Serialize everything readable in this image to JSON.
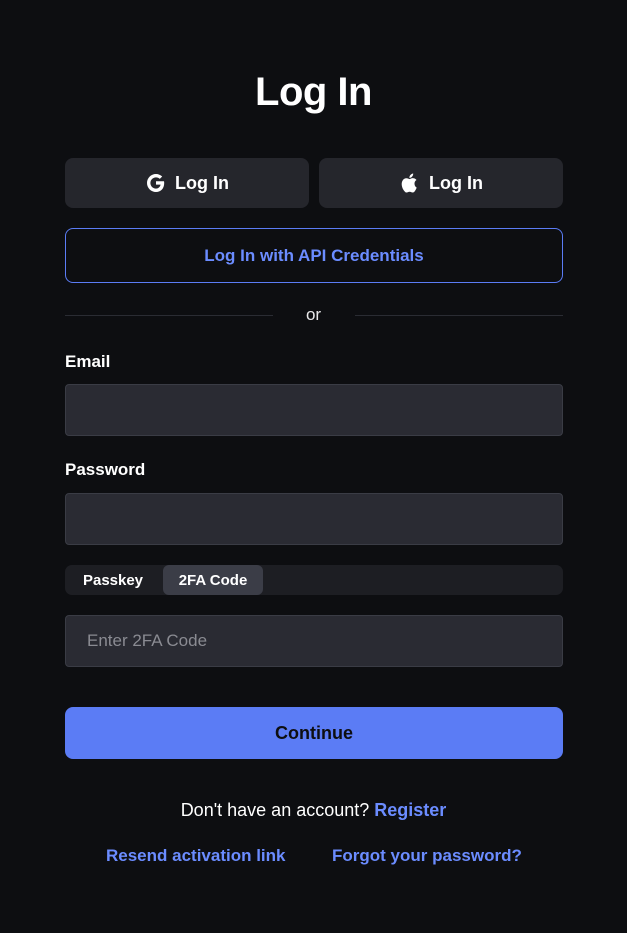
{
  "page": {
    "title": "Log In"
  },
  "social": {
    "google_label": "Log In",
    "apple_label": "Log In",
    "google_icon": "google-icon",
    "apple_icon": "apple-icon"
  },
  "api_button": {
    "label": "Log In with API Credentials"
  },
  "divider": {
    "text": "or"
  },
  "form": {
    "email_label": "Email",
    "email_value": "",
    "password_label": "Password",
    "password_value": "",
    "tabs": [
      {
        "label": "Passkey",
        "selected": false
      },
      {
        "label": "2FA Code",
        "selected": true
      }
    ],
    "twofa_placeholder": "Enter 2FA Code",
    "twofa_value": "",
    "continue_label": "Continue"
  },
  "footer": {
    "register_prompt": "Don't have an account?",
    "register_link": "Register",
    "resend_link": "Resend activation link",
    "forgot_link": "Forgot your password?"
  },
  "colors": {
    "background": "#0d0e11",
    "accent": "#5b7cf5",
    "link": "#6b8cff",
    "surface": "#25262c",
    "input_bg": "#2a2b33"
  }
}
